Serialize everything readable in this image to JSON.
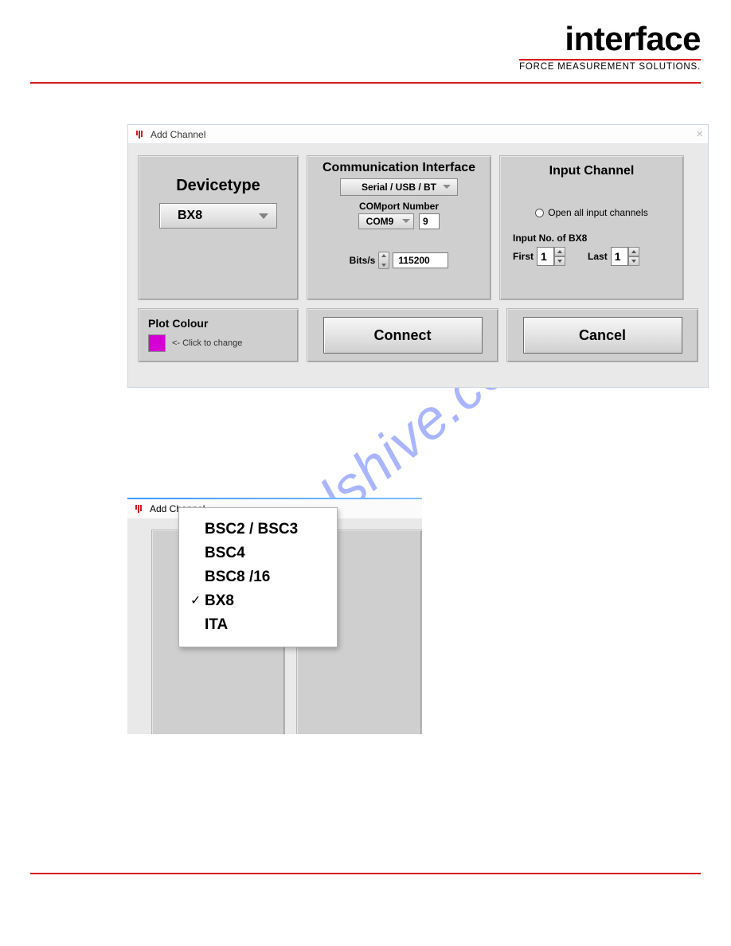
{
  "brand": {
    "word": "interface",
    "tag": "FORCE MEASUREMENT SOLUTIONS."
  },
  "win1": {
    "title": "Add Channel",
    "device": {
      "title": "Devicetype",
      "value": "BX8"
    },
    "comm": {
      "title": "Communication Interface",
      "serial": "Serial / USB / BT",
      "comport_label": "COMport Number",
      "comport_value": "COM9",
      "comport_num": "9",
      "bits_label": "Bits/s",
      "bits_value": "115200"
    },
    "input": {
      "title": "Input Channel",
      "open_all": "Open all input channels",
      "inputno_label": "Input No. of BX8",
      "first_label": "First",
      "first_value": "1",
      "last_label": "Last",
      "last_value": "1"
    },
    "plot": {
      "title": "Plot Colour",
      "hint": "<- Click to change"
    },
    "connect": "Connect",
    "cancel": "Cancel"
  },
  "win2": {
    "title": "Add Channel",
    "right_cut": "C"
  },
  "dropdown": {
    "items": [
      "BSC2 / BSC3",
      "BSC4",
      "BSC8 /16",
      "BX8",
      "ITA"
    ],
    "checked_index": 3
  },
  "watermark": "manualshive.com"
}
